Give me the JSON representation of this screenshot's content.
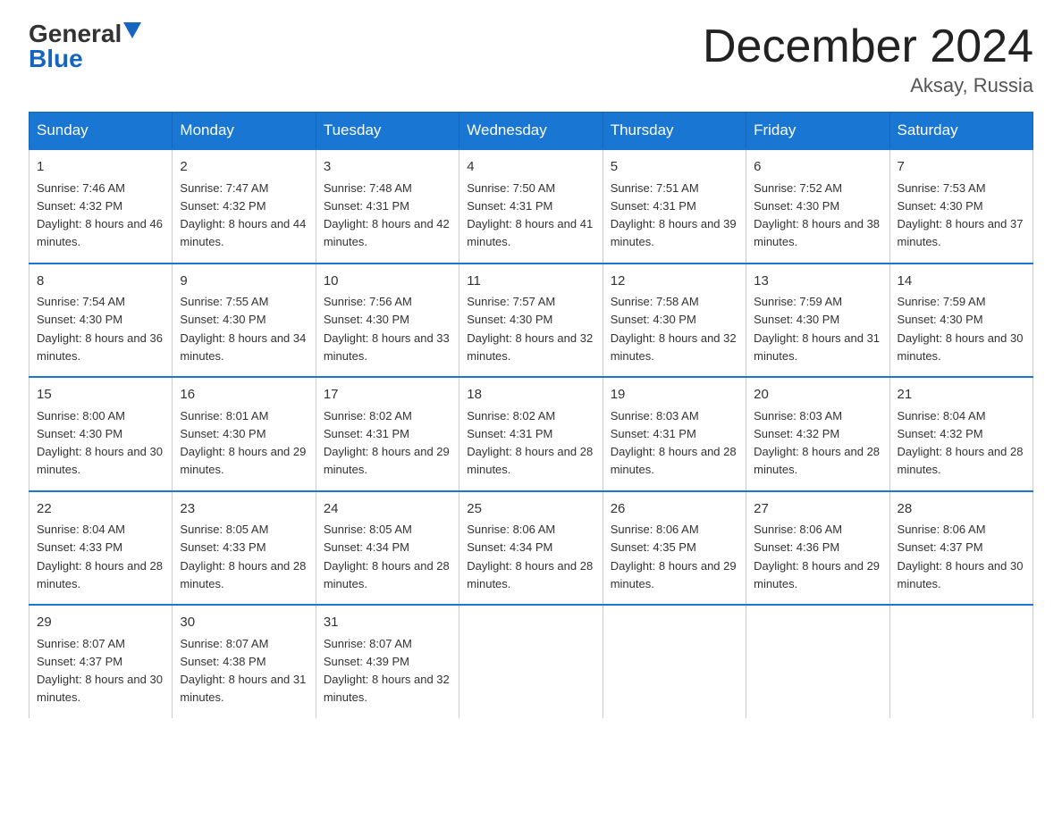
{
  "logo": {
    "general": "General",
    "blue": "Blue"
  },
  "title": "December 2024",
  "subtitle": "Aksay, Russia",
  "days_header": [
    "Sunday",
    "Monday",
    "Tuesday",
    "Wednesday",
    "Thursday",
    "Friday",
    "Saturday"
  ],
  "weeks": [
    [
      {
        "day": "1",
        "sunrise": "7:46 AM",
        "sunset": "4:32 PM",
        "daylight": "8 hours and 46 minutes."
      },
      {
        "day": "2",
        "sunrise": "7:47 AM",
        "sunset": "4:32 PM",
        "daylight": "8 hours and 44 minutes."
      },
      {
        "day": "3",
        "sunrise": "7:48 AM",
        "sunset": "4:31 PM",
        "daylight": "8 hours and 42 minutes."
      },
      {
        "day": "4",
        "sunrise": "7:50 AM",
        "sunset": "4:31 PM",
        "daylight": "8 hours and 41 minutes."
      },
      {
        "day": "5",
        "sunrise": "7:51 AM",
        "sunset": "4:31 PM",
        "daylight": "8 hours and 39 minutes."
      },
      {
        "day": "6",
        "sunrise": "7:52 AM",
        "sunset": "4:30 PM",
        "daylight": "8 hours and 38 minutes."
      },
      {
        "day": "7",
        "sunrise": "7:53 AM",
        "sunset": "4:30 PM",
        "daylight": "8 hours and 37 minutes."
      }
    ],
    [
      {
        "day": "8",
        "sunrise": "7:54 AM",
        "sunset": "4:30 PM",
        "daylight": "8 hours and 36 minutes."
      },
      {
        "day": "9",
        "sunrise": "7:55 AM",
        "sunset": "4:30 PM",
        "daylight": "8 hours and 34 minutes."
      },
      {
        "day": "10",
        "sunrise": "7:56 AM",
        "sunset": "4:30 PM",
        "daylight": "8 hours and 33 minutes."
      },
      {
        "day": "11",
        "sunrise": "7:57 AM",
        "sunset": "4:30 PM",
        "daylight": "8 hours and 32 minutes."
      },
      {
        "day": "12",
        "sunrise": "7:58 AM",
        "sunset": "4:30 PM",
        "daylight": "8 hours and 32 minutes."
      },
      {
        "day": "13",
        "sunrise": "7:59 AM",
        "sunset": "4:30 PM",
        "daylight": "8 hours and 31 minutes."
      },
      {
        "day": "14",
        "sunrise": "7:59 AM",
        "sunset": "4:30 PM",
        "daylight": "8 hours and 30 minutes."
      }
    ],
    [
      {
        "day": "15",
        "sunrise": "8:00 AM",
        "sunset": "4:30 PM",
        "daylight": "8 hours and 30 minutes."
      },
      {
        "day": "16",
        "sunrise": "8:01 AM",
        "sunset": "4:30 PM",
        "daylight": "8 hours and 29 minutes."
      },
      {
        "day": "17",
        "sunrise": "8:02 AM",
        "sunset": "4:31 PM",
        "daylight": "8 hours and 29 minutes."
      },
      {
        "day": "18",
        "sunrise": "8:02 AM",
        "sunset": "4:31 PM",
        "daylight": "8 hours and 28 minutes."
      },
      {
        "day": "19",
        "sunrise": "8:03 AM",
        "sunset": "4:31 PM",
        "daylight": "8 hours and 28 minutes."
      },
      {
        "day": "20",
        "sunrise": "8:03 AM",
        "sunset": "4:32 PM",
        "daylight": "8 hours and 28 minutes."
      },
      {
        "day": "21",
        "sunrise": "8:04 AM",
        "sunset": "4:32 PM",
        "daylight": "8 hours and 28 minutes."
      }
    ],
    [
      {
        "day": "22",
        "sunrise": "8:04 AM",
        "sunset": "4:33 PM",
        "daylight": "8 hours and 28 minutes."
      },
      {
        "day": "23",
        "sunrise": "8:05 AM",
        "sunset": "4:33 PM",
        "daylight": "8 hours and 28 minutes."
      },
      {
        "day": "24",
        "sunrise": "8:05 AM",
        "sunset": "4:34 PM",
        "daylight": "8 hours and 28 minutes."
      },
      {
        "day": "25",
        "sunrise": "8:06 AM",
        "sunset": "4:34 PM",
        "daylight": "8 hours and 28 minutes."
      },
      {
        "day": "26",
        "sunrise": "8:06 AM",
        "sunset": "4:35 PM",
        "daylight": "8 hours and 29 minutes."
      },
      {
        "day": "27",
        "sunrise": "8:06 AM",
        "sunset": "4:36 PM",
        "daylight": "8 hours and 29 minutes."
      },
      {
        "day": "28",
        "sunrise": "8:06 AM",
        "sunset": "4:37 PM",
        "daylight": "8 hours and 30 minutes."
      }
    ],
    [
      {
        "day": "29",
        "sunrise": "8:07 AM",
        "sunset": "4:37 PM",
        "daylight": "8 hours and 30 minutes."
      },
      {
        "day": "30",
        "sunrise": "8:07 AM",
        "sunset": "4:38 PM",
        "daylight": "8 hours and 31 minutes."
      },
      {
        "day": "31",
        "sunrise": "8:07 AM",
        "sunset": "4:39 PM",
        "daylight": "8 hours and 32 minutes."
      },
      null,
      null,
      null,
      null
    ]
  ]
}
